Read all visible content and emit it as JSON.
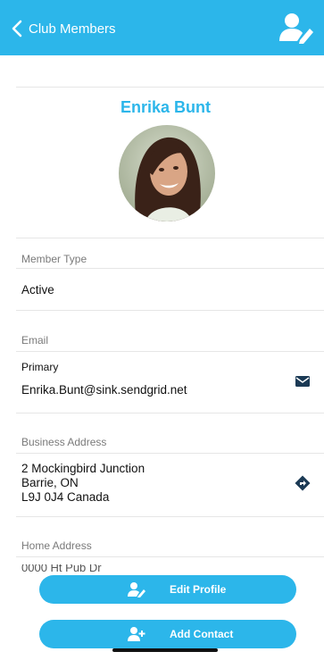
{
  "nav": {
    "back_label": "Club Members",
    "action_icon": "edit-user-icon",
    "bar_color": "#2cb6ea"
  },
  "profile": {
    "name": "Enrika Bunt",
    "avatar": "profile-photo"
  },
  "member_type": {
    "label": "Member Type",
    "value": "Active"
  },
  "email": {
    "label": "Email",
    "sub_label": "Primary",
    "value": "Enrika.Bunt@sink.sendgrid.net",
    "icon": "envelope-icon"
  },
  "business_address": {
    "label": "Business Address",
    "line1": "2 Mockingbird Junction",
    "line2": "Barrie, ON",
    "line3": "L9J 0J4 Canada",
    "icon": "directions-icon"
  },
  "home_address": {
    "label": "Home Address",
    "partial_line": "0000 Ht   Pub Dr"
  },
  "buttons": {
    "edit_profile": "Edit Profile",
    "add_contact": "Add Contact"
  }
}
